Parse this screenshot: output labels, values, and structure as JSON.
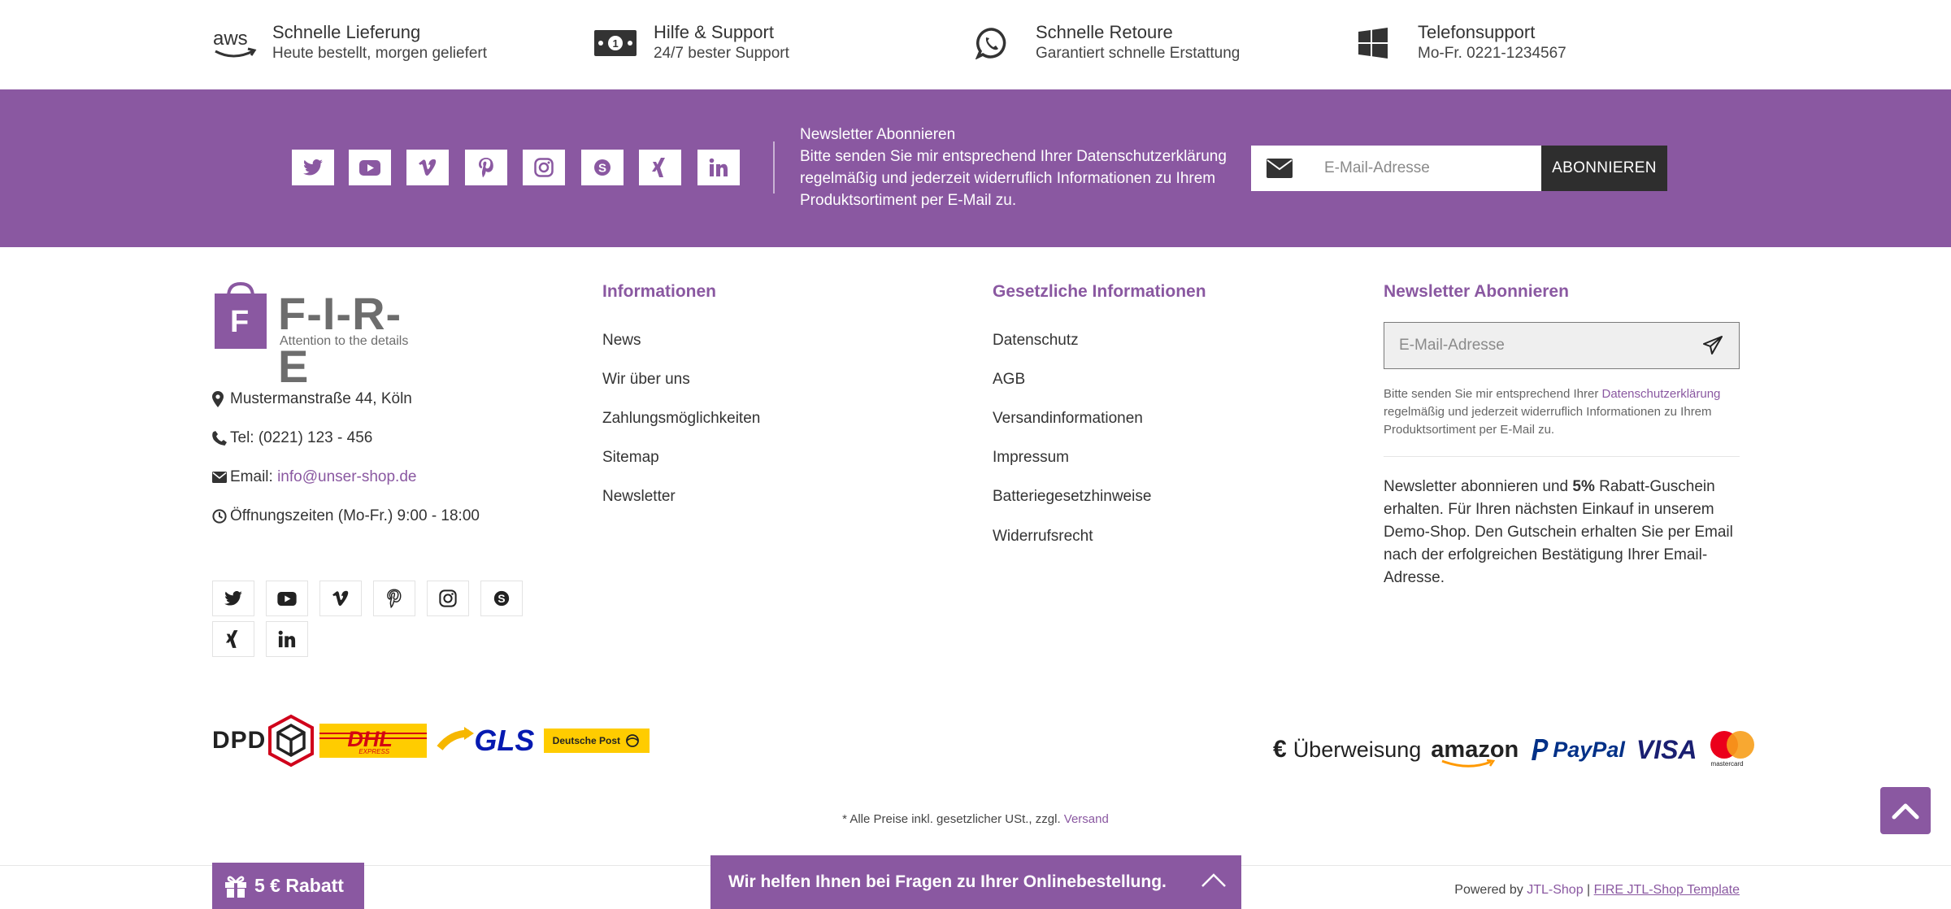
{
  "features": [
    {
      "icon": "aws-icon",
      "title": "Schnelle Lieferung",
      "subtitle": "Heute bestellt, morgen geliefert"
    },
    {
      "icon": "money-icon",
      "title": "Hilfe & Support",
      "subtitle": "24/7 bester Support"
    },
    {
      "icon": "whatsapp-icon",
      "title": "Schnelle Retoure",
      "subtitle": "Garantiert schnelle Erstattung"
    },
    {
      "icon": "windows-icon",
      "title": "Telefonsupport",
      "subtitle": "Mo-Fr. 0221-1234567"
    }
  ],
  "band": {
    "social": [
      "twitter-icon",
      "youtube-icon",
      "vimeo-icon",
      "pinterest-icon",
      "instagram-icon",
      "skype-icon",
      "xing-icon",
      "linkedin-icon"
    ],
    "newsletter_text": "Newsletter Abonnieren\nBitte senden Sie mir entsprechend Ihrer Datenschutzerklärung regelmäßig und jederzeit widerruflich Informationen zu Ihrem Produktsortiment per E-Mail zu.",
    "email_placeholder": "E-Mail-Adresse",
    "subscribe_label": "ABONNIEREN"
  },
  "logo": {
    "text": "F-I-R-E",
    "letter": "F",
    "tagline": "Attention to the details"
  },
  "contact": {
    "address": "Mustermanstraße 44, Köln",
    "tel": "Tel: (0221) 123 - 456",
    "email_label": "Email: ",
    "email": "info@unser-shop.de",
    "hours": "Öffnungszeiten (Mo-Fr.) 9:00 - 18:00"
  },
  "informationen": {
    "heading": "Informationen",
    "links": [
      "News",
      "Wir über uns",
      "Zahlungsmöglichkeiten",
      "Sitemap",
      "Newsletter"
    ]
  },
  "gesetzlich": {
    "heading": "Gesetzliche Informationen",
    "links": [
      "Datenschutz",
      "AGB",
      "Versandinformationen",
      "Impressum",
      "Batteriegesetzhinweise",
      "Widerrufsrecht"
    ]
  },
  "newsletter": {
    "heading": "Newsletter Abonnieren",
    "placeholder": "E-Mail-Adresse",
    "small_pre": "Bitte senden Sie mir entsprechend Ihrer ",
    "small_link": "Datenschutzerklärung",
    "small_post": " regelmäßig und jederzeit widerruflich Informationen zu Ihrem Produktsortiment per E-Mail zu.",
    "promo_pre": "Newsletter abonnieren und ",
    "promo_bold": "5%",
    "promo_post": " Rabatt-Guschein erhalten. Für Ihren nächsten Einkauf in unserem Demo-Shop. Den Gutschein erhalten Sie per Email nach der erfolgreichen Bestätigung Ihrer Email-Adresse."
  },
  "shipping": {
    "dpd": "DPD",
    "dhl": "DHL",
    "dhl_sub": "EXPRESS",
    "gls": "GLS",
    "post": "Deutsche Post"
  },
  "payment": {
    "euro": "€",
    "ueberweisung": "Überweisung",
    "amazon": "amazon",
    "paypal": "PayPal",
    "visa": "VISA",
    "mastercard": "mastercard"
  },
  "prices": {
    "text": "* Alle Preise inkl. gesetzlicher USt., zzgl. ",
    "link": "Versand"
  },
  "powered": {
    "pre": "Powered by ",
    "jtl": "JTL-Shop",
    "sep": " | ",
    "template": "FIRE JTL-Shop Template"
  },
  "rabatt": {
    "label": "5 € Rabatt"
  },
  "help": {
    "label": "Wir helfen Ihnen bei Fragen zu Ihrer Onlinebestellung."
  },
  "colors": {
    "accent": "#8a58a1",
    "dark": "#2e2e2e"
  }
}
